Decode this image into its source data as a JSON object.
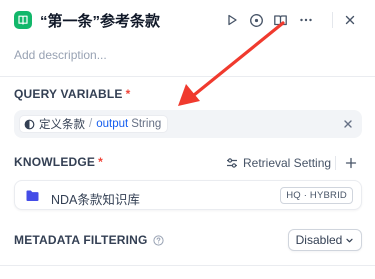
{
  "header": {
    "title": "“第一条”参考条款",
    "icons": [
      "knowledge-icon",
      "play-icon",
      "help-icon",
      "book-icon",
      "more-icon",
      "close-icon"
    ]
  },
  "description": {
    "placeholder": "Add description..."
  },
  "query_variable": {
    "label": "QUERY VARIABLE",
    "required": "*",
    "node": "定义条款",
    "separator": "/",
    "variable": "output",
    "type": "String"
  },
  "knowledge": {
    "label": "KNOWLEDGE",
    "required": "*",
    "retrieval_setting": "Retrieval Setting",
    "items": [
      {
        "name": "NDA条款知识库",
        "badge": "HQ · HYBRID"
      }
    ]
  },
  "metadata_filtering": {
    "label": "METADATA FILTERING",
    "value": "Disabled"
  },
  "colors": {
    "accent": "#155eef",
    "app_icon": "#12b76a",
    "folder": "#444ce7",
    "required": "#f04438",
    "annotation_arrow": "#f03a2e"
  }
}
